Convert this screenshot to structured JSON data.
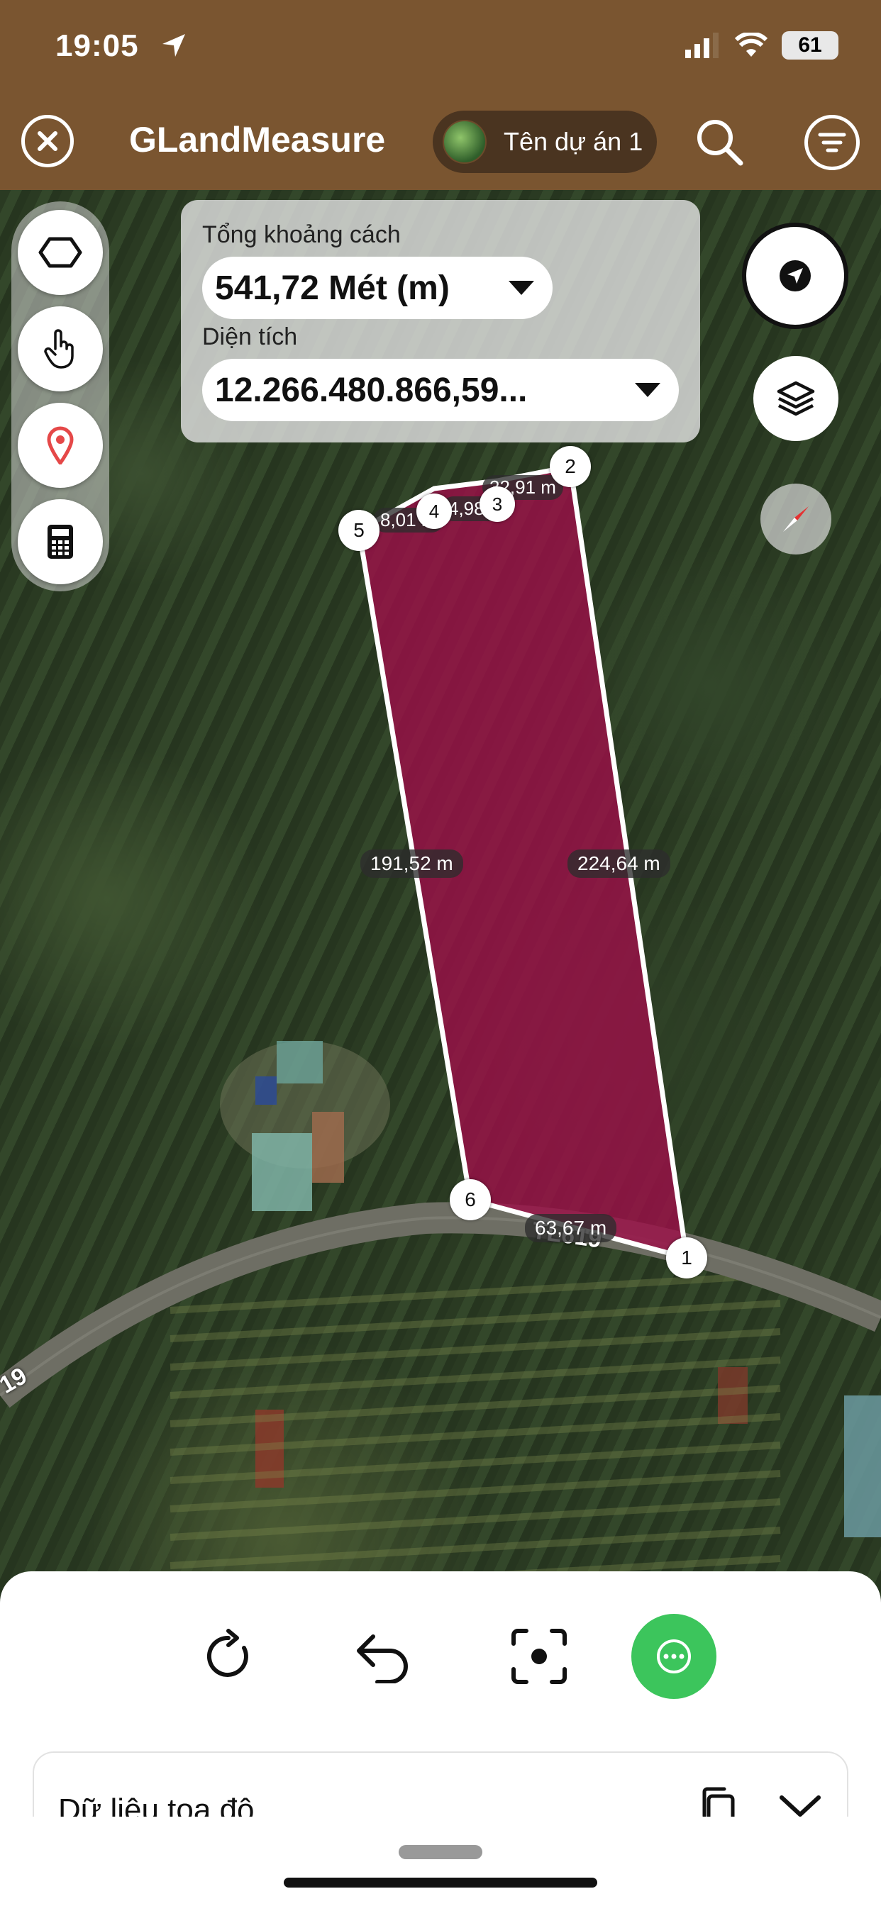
{
  "status_bar": {
    "time": "19:05",
    "battery": "61"
  },
  "header": {
    "title": "GLandMeasure",
    "project_name": "Tên dự án 1"
  },
  "measure_panel": {
    "distance_label": "Tổng khoảng cách",
    "distance_value": "541,72 Mét (m)",
    "area_label": "Diện tích",
    "area_value": "12.266.480.866,59..."
  },
  "map": {
    "polygon_color": "#9b1048",
    "vertices": [
      {
        "number": "1"
      },
      {
        "number": "2"
      },
      {
        "number": "3"
      },
      {
        "number": "4"
      },
      {
        "number": "5"
      },
      {
        "number": "6"
      }
    ],
    "edge_labels": {
      "left": "191,52 m",
      "right": "224,64 m",
      "bottom": "63,67 m",
      "top_2": "32,91 m",
      "top_5": "8,01 m",
      "top_4": "4,98 m"
    },
    "road_labels": {
      "road_a": "TL619",
      "road_b": "19"
    }
  },
  "bottom_sheet": {
    "coord_section_title": "Dữ liệu tọa độ"
  },
  "colors": {
    "header_bg": "#7a5530",
    "accent_green": "#3cc55c"
  },
  "icons": [
    "close-icon",
    "search-icon",
    "filter-menu-icon",
    "polygon-icon",
    "hand-tap-icon",
    "location-pin-icon",
    "calculator-icon",
    "navigation-arrow-icon",
    "layers-icon",
    "compass-icon",
    "refresh-icon",
    "undo-icon",
    "focus-icon",
    "more-icon",
    "copy-icon",
    "chevron-down-icon"
  ]
}
